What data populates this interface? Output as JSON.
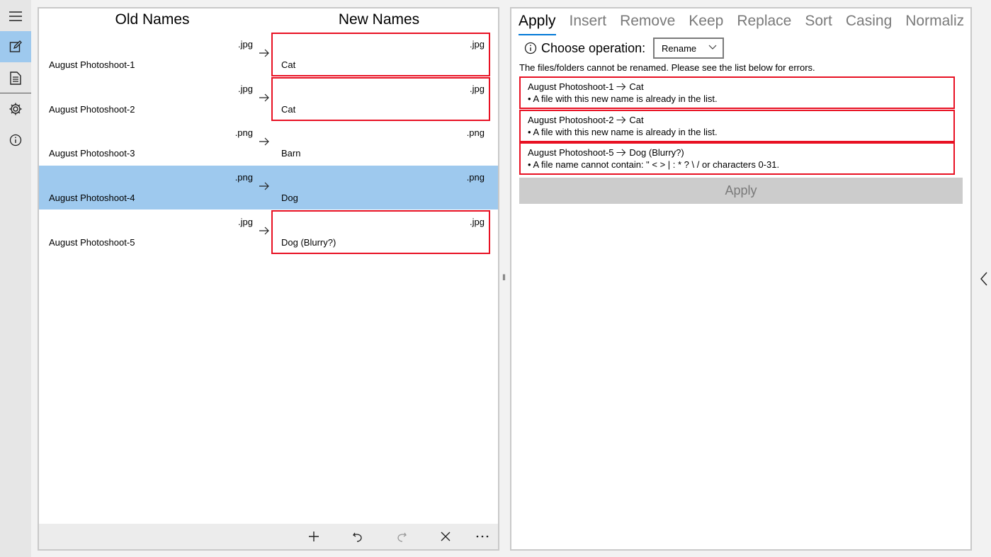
{
  "rail": {
    "items": [
      {
        "name": "hamburger-icon"
      },
      {
        "name": "edit-icon",
        "active": true
      },
      {
        "name": "document-icon"
      },
      {
        "name": "gear-icon"
      },
      {
        "name": "info-icon"
      }
    ]
  },
  "left": {
    "old_header": "Old Names",
    "new_header": "New Names",
    "rows": [
      {
        "old_name": "August Photoshoot-1",
        "old_ext": ".jpg",
        "new_name": "Cat",
        "new_ext": ".jpg",
        "error": true,
        "selected": false
      },
      {
        "old_name": "August Photoshoot-2",
        "old_ext": ".jpg",
        "new_name": "Cat",
        "new_ext": ".jpg",
        "error": true,
        "selected": false
      },
      {
        "old_name": "August Photoshoot-3",
        "old_ext": ".png",
        "new_name": "Barn",
        "new_ext": ".png",
        "error": false,
        "selected": false
      },
      {
        "old_name": "August Photoshoot-4",
        "old_ext": ".png",
        "new_name": "Dog",
        "new_ext": ".png",
        "error": false,
        "selected": true
      },
      {
        "old_name": "August Photoshoot-5",
        "old_ext": ".jpg",
        "new_name": "Dog (Blurry?)",
        "new_ext": ".jpg",
        "error": true,
        "selected": false
      }
    ],
    "toolbar": {
      "add_icon": "plus-icon",
      "undo_icon": "undo-icon",
      "redo_icon": "redo-icon",
      "clear_icon": "close-icon",
      "more_icon": "more-icon"
    }
  },
  "right": {
    "tabs": [
      "Apply",
      "Insert",
      "Remove",
      "Keep",
      "Replace",
      "Sort",
      "Casing",
      "Normaliz"
    ],
    "active_tab": 0,
    "choose_operation_label": "Choose operation:",
    "operation_value": "Rename",
    "error_message": "The files/folders cannot be renamed. Please see the list below for errors.",
    "errors": [
      {
        "old": "August Photoshoot-1",
        "new": "Cat",
        "detail": "• A file with this new name is already in the list."
      },
      {
        "old": "August Photoshoot-2",
        "new": "Cat",
        "detail": "• A file with this new name is already in the list."
      },
      {
        "old": "August Photoshoot-5",
        "new": "Dog (Blurry?)",
        "detail": "• A file name cannot contain: \" < > | : * ? \\ / or characters 0-31."
      }
    ],
    "apply_label": "Apply"
  },
  "colors": {
    "accent": "#0078d7",
    "selected_row": "#9ec9ee",
    "error_border": "#e81123"
  }
}
